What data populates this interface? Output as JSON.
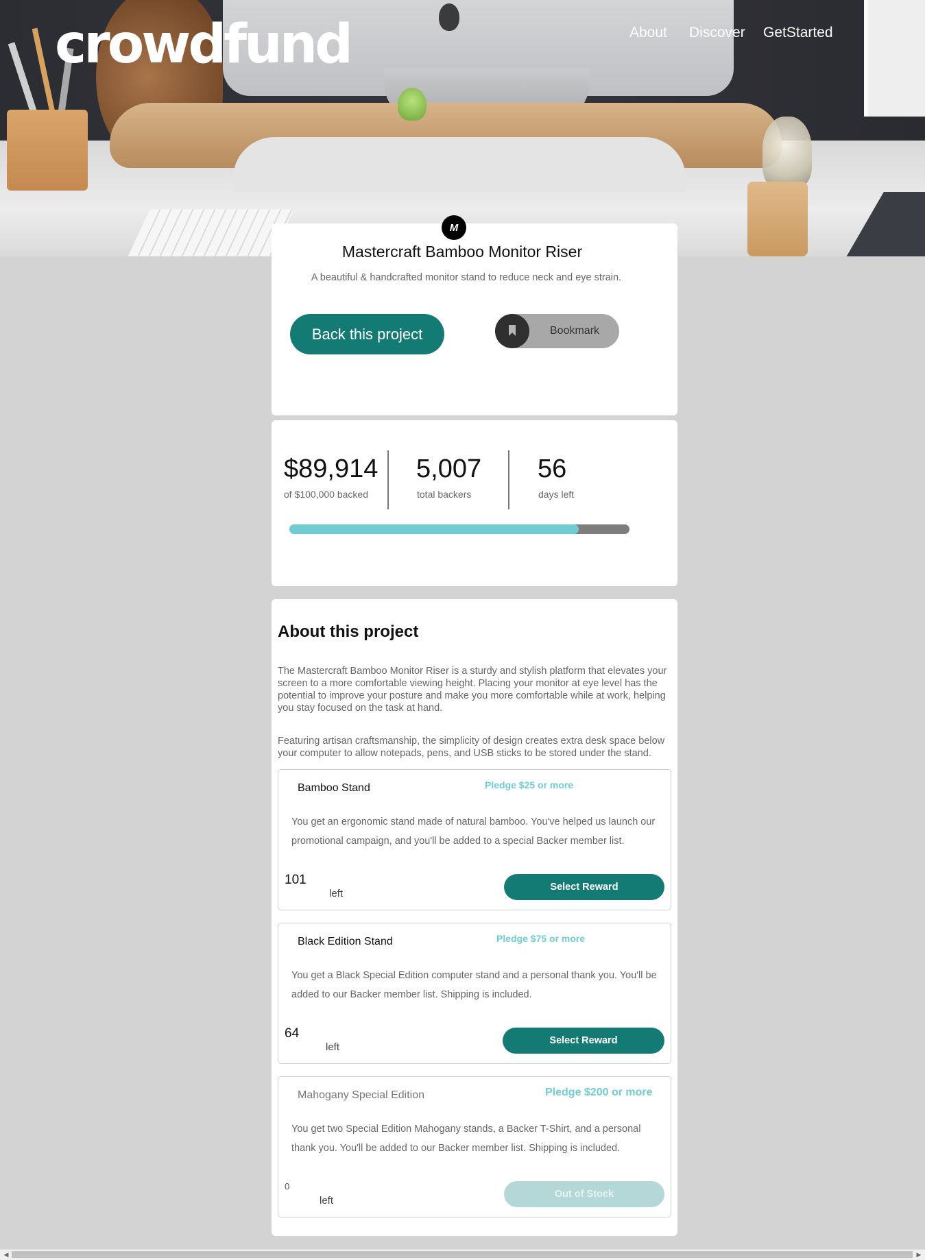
{
  "brand": {
    "logo": "crowdfund"
  },
  "nav": {
    "items": [
      "About",
      "Discover",
      "GetStarted"
    ]
  },
  "project": {
    "logo_badge": "M",
    "title": "Mastercraft Bamboo Monitor Riser",
    "subtitle": "A beautiful & handcrafted monitor stand to reduce neck and eye strain.",
    "back_label": "Back this project",
    "bookmark_label": "Bookmark"
  },
  "stats": {
    "backed_amount": "$89,914",
    "backed_label": "of $100,000 backed",
    "backers": "5,007",
    "backers_label": "total backers",
    "days": "56",
    "days_label": "days left",
    "progress": 0.85
  },
  "about": {
    "title": "About this project",
    "paragraphs": [
      "The Mastercraft Bamboo Monitor Riser is a sturdy and stylish platform that elevates your screen to a more comfortable viewing height. Placing your monitor at eye level has the potential to improve your posture and make you more comfortable while at work, helping you stay focused on the task at hand.",
      "Featuring artisan craftsmanship, the simplicity of design creates extra desk space below your computer to allow notepads, pens, and USB sticks to be stored under the stand."
    ]
  },
  "rewards": [
    {
      "name": "Bamboo Stand",
      "pledge": "Pledge $25 or more",
      "description": "You get an ergonomic stand made of natural bamboo. You've helped us launch our promotional campaign, and you'll be added to a special Backer member list.",
      "count": "101",
      "left_label": "left",
      "button": "Select Reward"
    },
    {
      "name": "Black Edition Stand",
      "pledge": "Pledge $75 or more",
      "description": "You get a Black Special Edition computer stand and a personal thank you. You'll be added to our Backer member list. Shipping is included.",
      "count": "64",
      "left_label": "left",
      "button": "Select Reward"
    },
    {
      "name": "Mahogany Special Edition",
      "pledge": "Pledge $200 or more",
      "description": "You get two Special Edition Mahogany stands, a Backer T-Shirt, and a personal thank you. You'll be added to our Backer member list. Shipping is included.",
      "count": "0",
      "left_label": "left",
      "button": "Out of Stock"
    }
  ],
  "colors": {
    "primary": "#147b74",
    "accent": "#6fcdd1",
    "background": "#d3d3d3"
  },
  "icons": {
    "bookmark": "bookmark-icon",
    "scroll_left": "arrow-left-icon",
    "scroll_right": "arrow-right-icon"
  }
}
